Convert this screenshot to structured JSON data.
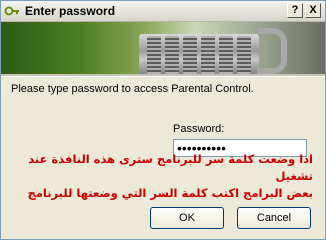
{
  "window": {
    "title": "Enter password",
    "help_button": "?",
    "close_button": "X"
  },
  "dialog": {
    "prompt": "Please type password to access Parental Control.",
    "password_label": "Password:",
    "password_value": "••••••••••",
    "note_line1": "اذا وضعت كلمة سر للبرنامج سترى هذه النافذة عند تشغيل",
    "note_line2": "بعض البرامج اكتب كلمة السر التي وضعتها للبرنامج",
    "ok_label": "OK",
    "cancel_label": "Cancel"
  },
  "colors": {
    "note_text": "#cc0000",
    "window_bg": "#ece9d8"
  }
}
